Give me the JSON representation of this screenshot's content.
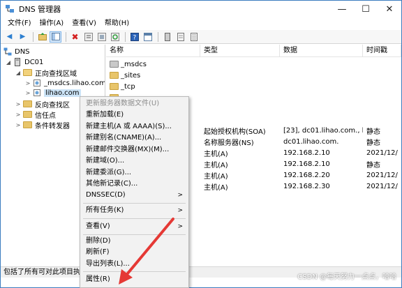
{
  "window": {
    "title": "DNS 管理器"
  },
  "menu": [
    "文件(F)",
    "操作(A)",
    "查看(V)",
    "帮助(H)"
  ],
  "tree": {
    "root": "DNS",
    "server": "DC01",
    "forward_zones": "正向查找区域",
    "zone1": "_msdcs.lihao.com",
    "zone2": "lihao.com",
    "reverse_zones": "反向查找区",
    "trust_points": "信任点",
    "conditional_forwarders": "条件转发器"
  },
  "list": {
    "headers": [
      "名称",
      "类型",
      "数据",
      "时间戳"
    ],
    "rows": [
      {
        "name": "_msdcs",
        "type": "",
        "data": "",
        "time": ""
      },
      {
        "name": "_sites",
        "type": "",
        "data": "",
        "time": ""
      },
      {
        "name": "_tcp",
        "type": "",
        "data": "",
        "time": ""
      },
      {
        "name": "",
        "type": "",
        "data": "",
        "time": ""
      },
      {
        "name": "",
        "type": "",
        "data": "",
        "time": ""
      },
      {
        "name": "",
        "type": "起始授权机构(SOA)",
        "data": "[23], dc01.lihao.com., h...",
        "time": "静态"
      },
      {
        "name": "",
        "type": "名称服务器(NS)",
        "data": "dc01.lihao.com.",
        "time": "静态"
      },
      {
        "name": "",
        "type": "主机(A)",
        "data": "192.168.2.10",
        "time": "2021/12/"
      },
      {
        "name": "",
        "type": "主机(A)",
        "data": "192.168.2.10",
        "time": "静态"
      },
      {
        "name": "",
        "type": "主机(A)",
        "data": "192.168.2.20",
        "time": "2021/12/"
      },
      {
        "name": "",
        "type": "主机(A)",
        "data": "192.168.2.30",
        "time": "2021/12/"
      }
    ]
  },
  "context_menu": {
    "items": [
      "更新服务器数据文件(U)",
      "重新加载(E)",
      "新建主机(A 或 AAAA)(S)...",
      "新建别名(CNAME)(A)...",
      "新建邮件交换器(MX)(M)...",
      "新建域(O)...",
      "新建委派(G)...",
      "其他新记录(C)...",
      "DNSSEC(D)",
      "所有任务(K)",
      "查看(V)",
      "删除(D)",
      "刷新(F)",
      "导出列表(L)...",
      "属性(R)"
    ]
  },
  "status": {
    "text": "包括了所有可对此项目执"
  },
  "watermark": "CSDN @每天努力一点点，哈哈"
}
